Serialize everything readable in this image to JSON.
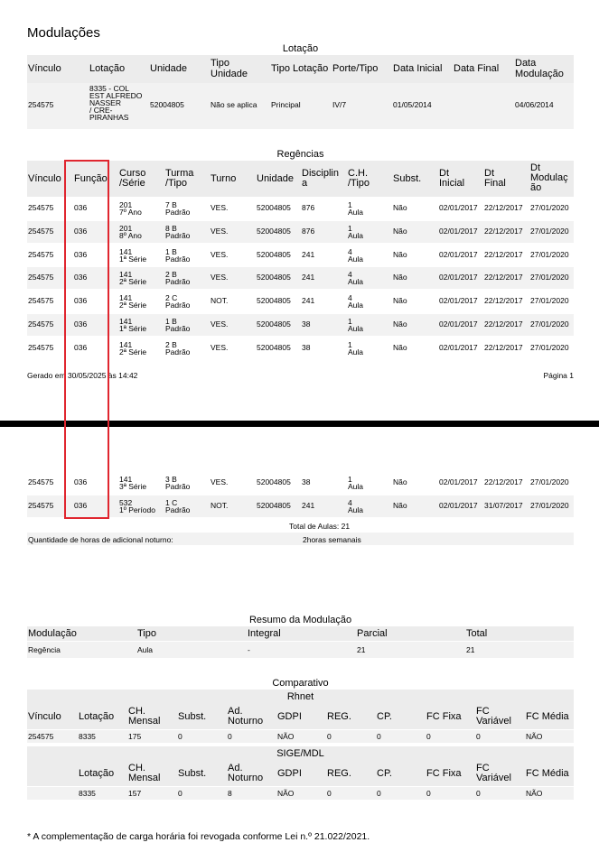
{
  "page_title": "Modulações",
  "lotacao": {
    "section_title": "Lotação",
    "headers": [
      "Vínculo",
      "Lotação",
      "Unidade",
      "Tipo\nUnidade",
      "Tipo Lotação",
      "Porte/Tipo",
      "Data Inicial",
      "Data Final",
      "Data\nModulação"
    ],
    "row": [
      "254575",
      "8335 - COL\nEST ALFREDO\nNASSER\n/ CRE-\nPIRANHAS",
      "52004805",
      "Não se aplica",
      "Principal",
      "IV/7",
      "01/05/2014",
      "",
      "04/06/2014"
    ]
  },
  "regencias": {
    "section_title": "Regências",
    "headers": [
      "Vínculo",
      "Função",
      "Curso\n/Série",
      "Turma\n/Tipo",
      "Turno",
      "Unidade",
      "Disciplin\na",
      "C.H.\n/Tipo",
      "Subst.",
      "Dt\nInicial",
      "Dt\nFinal",
      "Dt\nModulaç\não"
    ],
    "rows": [
      [
        "254575",
        "036",
        "201\n7º Ano",
        "7 B\nPadrão",
        "VES.",
        "52004805",
        "876",
        "1\nAula",
        "Não",
        "02/01/2017",
        "22/12/2017",
        "27/01/2020"
      ],
      [
        "254575",
        "036",
        "201\n8º Ano",
        "8 B\nPadrão",
        "VES.",
        "52004805",
        "876",
        "1\nAula",
        "Não",
        "02/01/2017",
        "22/12/2017",
        "27/01/2020"
      ],
      [
        "254575",
        "036",
        "141\n1ª Série",
        "1  B\nPadrão",
        "VES.",
        "52004805",
        "241",
        "4\nAula",
        "Não",
        "02/01/2017",
        "22/12/2017",
        "27/01/2020"
      ],
      [
        "254575",
        "036",
        "141\n2ª Série",
        "2 B\nPadrão",
        "VES.",
        "52004805",
        "241",
        "4\nAula",
        "Não",
        "02/01/2017",
        "22/12/2017",
        "27/01/2020"
      ],
      [
        "254575",
        "036",
        "141\n2ª Série",
        "2 C\nPadrão",
        "NOT.",
        "52004805",
        "241",
        "4\nAula",
        "Não",
        "02/01/2017",
        "22/12/2017",
        "27/01/2020"
      ],
      [
        "254575",
        "036",
        "141\n1ª Série",
        "1  B\nPadrão",
        "VES.",
        "52004805",
        "38",
        "1\nAula",
        "Não",
        "02/01/2017",
        "22/12/2017",
        "27/01/2020"
      ],
      [
        "254575",
        "036",
        "141\n2ª Série",
        "2 B\nPadrão",
        "VES.",
        "52004805",
        "38",
        "1\nAula",
        "Não",
        "02/01/2017",
        "22/12/2017",
        "27/01/2020"
      ]
    ],
    "rows_page2": [
      [
        "254575",
        "036",
        "141\n3ª Série",
        "3  B\nPadrão",
        "VES.",
        "52004805",
        "38",
        "1\nAula",
        "Não",
        "02/01/2017",
        "22/12/2017",
        "27/01/2020"
      ],
      [
        "254575",
        "036",
        "532\n1º Período",
        "1 C\nPadrão",
        "NOT.",
        "52004805",
        "241",
        "4\nAula",
        "Não",
        "02/01/2017",
        "31/07/2017",
        "27/01/2020"
      ]
    ],
    "total_aulas": "Total de Aulas:  21",
    "noturno_label": "Quantidade de horas de adicional noturno:",
    "noturno_value": "2horas semanais"
  },
  "footer": {
    "generated": "Gerado em 30/05/2025 às 14:42",
    "page": "Página 1"
  },
  "resumo": {
    "section_title": "Resumo da Modulação",
    "headers": [
      "Modulação",
      "Tipo",
      "Integral",
      "Parcial",
      "Total"
    ],
    "row": [
      "Regência",
      "Aula",
      "-",
      "21",
      "21"
    ]
  },
  "comparativo": {
    "section_title": "Comparativo",
    "rhnet_title": "Rhnet",
    "rhnet_headers": [
      "Vínculo",
      "Lotação",
      "CH.\nMensal",
      "Subst.",
      "Ad.\nNoturno",
      "GDPI",
      "REG.",
      "CP.",
      "FC Fixa",
      "FC\nVariável",
      "FC Média"
    ],
    "rhnet_row": [
      "254575",
      "8335",
      "175",
      "0",
      "0",
      "NÃO",
      "0",
      "0",
      "0",
      "0",
      "NÃO"
    ],
    "sige_title": "SIGE/MDL",
    "sige_headers": [
      "",
      "Lotação",
      "CH.\nMensal",
      "Subst.",
      "Ad.\nNoturno",
      "GDPI",
      "REG.",
      "CP.",
      "FC Fixa",
      "FC\nVariável",
      "FC Média"
    ],
    "sige_row": [
      "",
      "8335",
      "157",
      "0",
      "8",
      "NÃO",
      "0",
      "0",
      "0",
      "0",
      "NÃO"
    ]
  },
  "note": "* A complementação de carga horária foi revogada conforme Lei n.º 21.022/2021."
}
